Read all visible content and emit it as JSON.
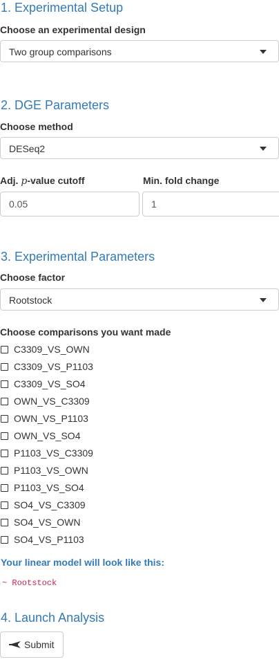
{
  "setup": {
    "title": "1. Experimental Setup",
    "design_label": "Choose an experimental design",
    "design_value": "Two group comparisons"
  },
  "dge": {
    "title": "2. DGE Parameters",
    "method_label": "Choose method",
    "method_value": "DESeq2",
    "pvalue_label_prefix": "Adj. ",
    "pvalue_label_var": "p",
    "pvalue_label_suffix": "-value cutoff",
    "pvalue_value": "0.05",
    "fold_label": "Min. fold change",
    "fold_value": "1"
  },
  "params": {
    "title": "3. Experimental Parameters",
    "factor_label": "Choose factor",
    "factor_value": "Rootstock",
    "comparisons_label": "Choose comparisons you want made",
    "comparisons": [
      {
        "label": "C3309_VS_OWN",
        "checked": false
      },
      {
        "label": "C3309_VS_P1103",
        "checked": false
      },
      {
        "label": "C3309_VS_SO4",
        "checked": false
      },
      {
        "label": "OWN_VS_C3309",
        "checked": false
      },
      {
        "label": "OWN_VS_P1103",
        "checked": false
      },
      {
        "label": "OWN_VS_SO4",
        "checked": false
      },
      {
        "label": "P1103_VS_C3309",
        "checked": false
      },
      {
        "label": "P1103_VS_OWN",
        "checked": false
      },
      {
        "label": "P1103_VS_SO4",
        "checked": false
      },
      {
        "label": "SO4_VS_C3309",
        "checked": false
      },
      {
        "label": "SO4_VS_OWN",
        "checked": false
      },
      {
        "label": "SO4_VS_P1103",
        "checked": false
      }
    ],
    "model_heading": "Your linear model will look like this:",
    "model_formula": "~ Rootstock"
  },
  "launch": {
    "title": "4. Launch Analysis",
    "submit_label": "Submit",
    "submit_icon": "paper-plane-icon"
  },
  "colors": {
    "heading": "#337ab7",
    "formula": "#c7254e",
    "border": "#cccccc"
  }
}
